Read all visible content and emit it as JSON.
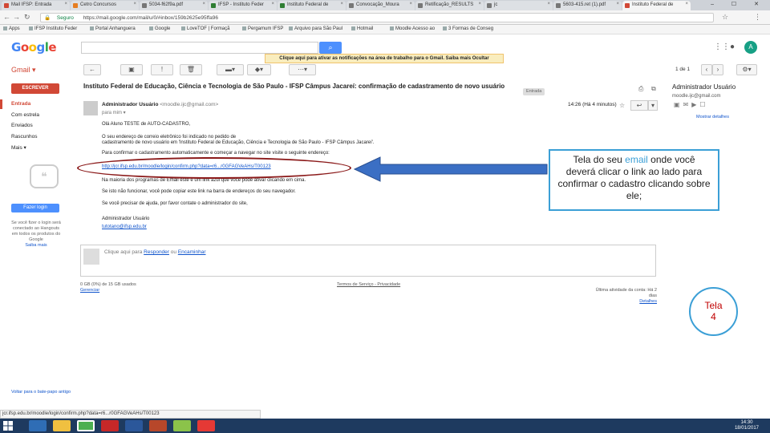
{
  "browser": {
    "tabs": [
      {
        "label": "Mail IFSP: Entrada",
        "fav": "#d14836"
      },
      {
        "label": "Cetro Concursos",
        "fav": "#e67e22"
      },
      {
        "label": "5034-f62f9a.pdf",
        "fav": "#777"
      },
      {
        "label": "IFSP - Instituto Feder",
        "fav": "#2e7d32"
      },
      {
        "label": "Instituto Federal de",
        "fav": "#2e7d32"
      },
      {
        "label": "Convocação_Moura",
        "fav": "#777"
      },
      {
        "label": "Retificação_RESULTS",
        "fav": "#777"
      },
      {
        "label": "jc",
        "fav": "#777"
      },
      {
        "label": "5603-415.ret (1).pdf",
        "fav": "#777"
      },
      {
        "label": "Instituto Federal de",
        "fav": "#d14836"
      }
    ],
    "window_controls": "– ☐ ✕",
    "secure_label": "Seguro",
    "url": "https://mail.google.com/mail/u/0/#inbox/159b2625e95ffa96",
    "bookmarks": [
      "Apps",
      "IFSP Instituto Feder",
      "Portal Anhanguera",
      "Google",
      "LoveTOF | Formaçã",
      "Pergamum IFSP",
      "Arquivo para São Paul",
      "Hotmail",
      "Moodle Acesso ao",
      "3 Formas de Conseg"
    ]
  },
  "gmail": {
    "logo_letters": [
      "G",
      "o",
      "o",
      "g",
      "l",
      "e"
    ],
    "logo_colors": [
      "#4285f4",
      "#ea4335",
      "#fbbc05",
      "#4285f4",
      "#34a853",
      "#ea4335"
    ],
    "search_button_icon": "search-icon",
    "app_label": "Gmail ▾",
    "notification": "Clique aqui para ativar as notificações na área de trabalho para o Gmail.   Saiba mais   Ocultar",
    "pager": "1 de 1",
    "compose_label": "ESCREVER",
    "nav": [
      "Entrada",
      "Com estrela",
      "Enviados",
      "Rascunhos",
      "Mais ▾"
    ],
    "hangouts_login": "Fazer login",
    "hangouts_text": "Se você fizer o login será conectado ao Hangouts em todos os produtos do Google",
    "hangouts_link": "Saiba mais",
    "left_footer": "Voltar para o bate-papo antigo"
  },
  "message": {
    "subject": "Instituto Federal de Educação, Ciência e Tecnologia de São Paulo - IFSP Câmpus Jacareí: confirmação de cadastramento de novo usuário",
    "label": "Entrada",
    "from_name": "Administrador Usuário",
    "from_email": "<moodle.ijc@gmail.com>",
    "to": "para mim ▾",
    "time": "14:26 (Há 4 minutos)",
    "body": [
      "Olá Aluno TESTE de AUTO-CADASTRO,",
      "O seu endereço de correio eletrônico foi indicado no pedido de",
      "cadastramento de novo usuário em 'Instituto Federal de Educação, Ciência e Tecnologia de São Paulo - IFSP Câmpus Jacareí'.",
      "Para confirmar o cadastramento automaticamente e começar a navegar no site visite o seguinte endereço:",
      "http://jcr.ifsp.edu.br/moodle/login/confirm.php?data=r6...r0GFAGVeAHs/T00123",
      "Na maioria dos programas de Email este é um link azul que você pode ativar clicando em cima.",
      "Se isto não funcionar, você pode copiar este link na barra de endereços do seu navegador.",
      "Se você precisar de ajuda, por favor contate o administrador do site,",
      "Administrador Usuário",
      "tutotano@ifsp.edu.br"
    ],
    "reply_prefix": "Clique aqui para ",
    "reply_link1": "Responder",
    "reply_mid": " ou ",
    "reply_link2": "Encaminhar"
  },
  "footer": {
    "storage": "0 GB (0%) de 15 GB usados",
    "manage": "Gerenciar",
    "terms": "Termos de Serviço - Privacidade",
    "activity": "Última atividade da conta: Há 2 dias",
    "details": "Detalhes"
  },
  "right_panel": {
    "name": "Administrador Usuário",
    "email": "moodle.ijc@gmail.com",
    "more": "Mostrar detalhes"
  },
  "annotations": {
    "callout_line1a": "Tela do seu ",
    "callout_email": "email",
    "callout_line1b": " onde você",
    "callout_rest": "deverá clicar o link ao lado para confirmar o cadastro clicando sobre ele;",
    "tela_label": "Tela",
    "tela_number": "4"
  },
  "status_url": "jcr.ifsp.edu.br/moodle/login/confirm.php?data=r6...r0GFAGVeAHs/T00123",
  "taskbar": {
    "time": "14:30",
    "date": "18/01/2017"
  }
}
